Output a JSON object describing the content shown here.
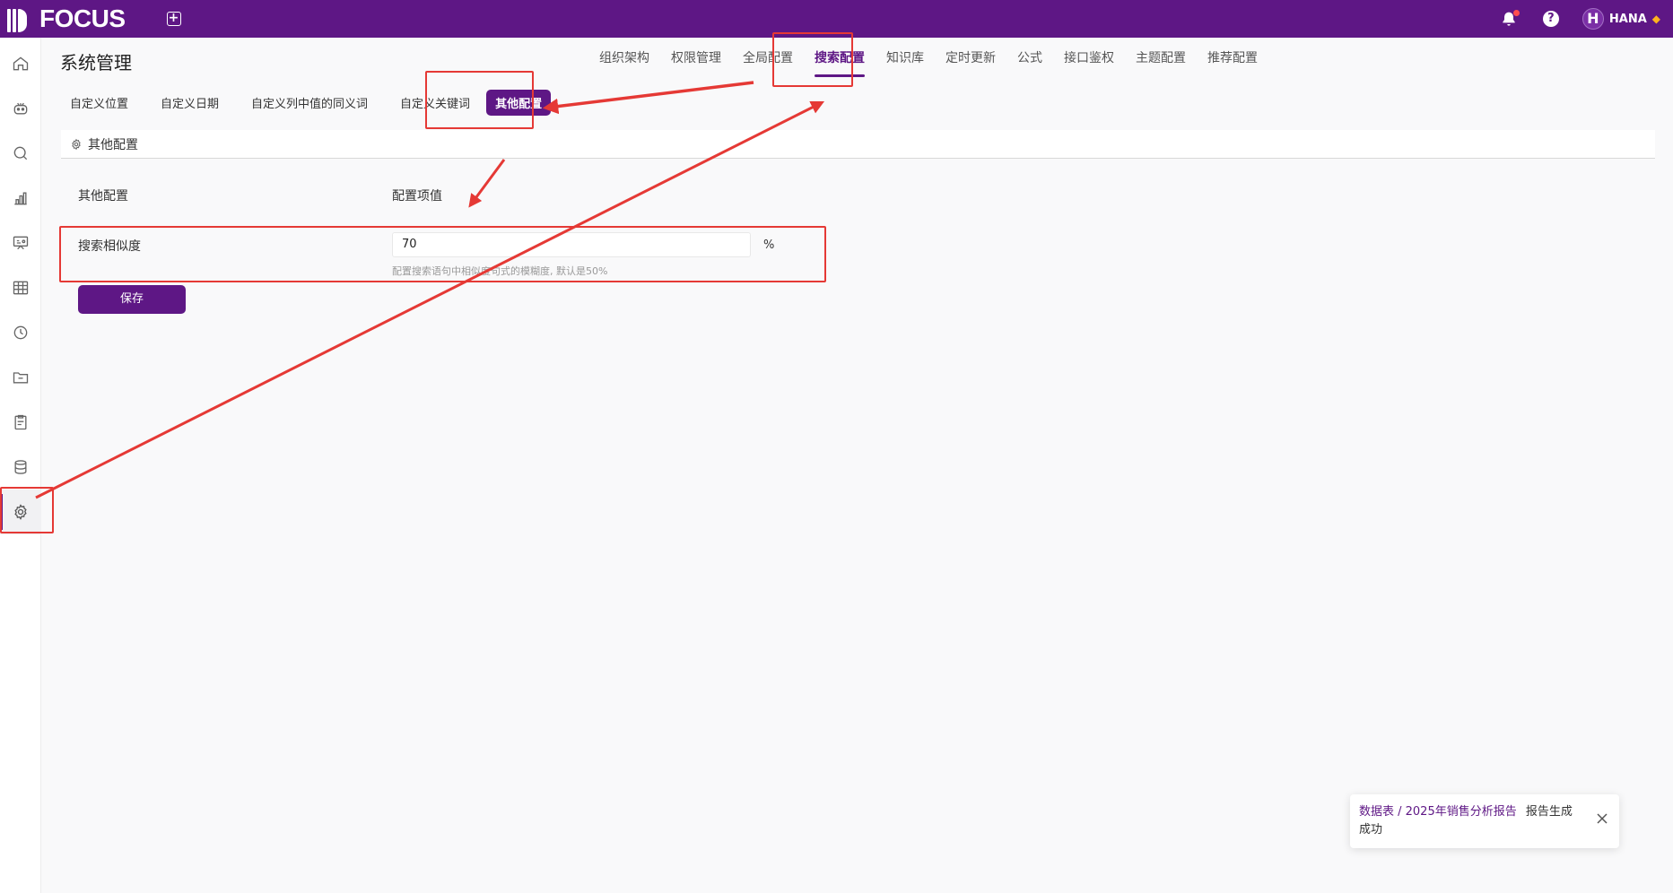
{
  "app": {
    "logo_text": "FOCUS",
    "new_tab_icon": "plus-square-icon"
  },
  "topbar": {
    "user_initial": "H",
    "user_name": "HANA",
    "help_symbol": "?"
  },
  "sidebar": {
    "items": [
      {
        "icon": "home-icon"
      },
      {
        "icon": "robot-icon"
      },
      {
        "icon": "search-icon"
      },
      {
        "icon": "bar-chart-icon"
      },
      {
        "icon": "presentation-icon"
      },
      {
        "icon": "table-icon"
      },
      {
        "icon": "clock-icon"
      },
      {
        "icon": "folder-icon"
      },
      {
        "icon": "clipboard-icon"
      },
      {
        "icon": "database-icon"
      },
      {
        "icon": "gear-icon",
        "active": true
      }
    ]
  },
  "page": {
    "title": "系统管理"
  },
  "main_tabs": [
    {
      "label": "组织架构"
    },
    {
      "label": "权限管理"
    },
    {
      "label": "全局配置"
    },
    {
      "label": "搜索配置",
      "active": true
    },
    {
      "label": "知识库"
    },
    {
      "label": "定时更新"
    },
    {
      "label": "公式"
    },
    {
      "label": "接口鉴权"
    },
    {
      "label": "主题配置"
    },
    {
      "label": "推荐配置"
    }
  ],
  "sub_tabs": [
    {
      "label": "自定义位置"
    },
    {
      "label": "自定义日期"
    },
    {
      "label": "自定义列中值的同义词"
    },
    {
      "label": "自定义关键词"
    },
    {
      "label": "其他配置",
      "active": true
    }
  ],
  "section": {
    "title": "其他配置",
    "col_name": "其他配置",
    "col_value": "配置项值",
    "row": {
      "label": "搜索相似度",
      "value": "70",
      "unit": "%",
      "hint": "配置搜索语句中相似度句式的模糊度, 默认是50%"
    },
    "save_label": "保存"
  },
  "toast": {
    "link_text": "数据表 / 2025年销售分析报告",
    "message": "报告生成成功"
  },
  "colors": {
    "brand": "#5e1785",
    "annotation": "#e53935"
  }
}
